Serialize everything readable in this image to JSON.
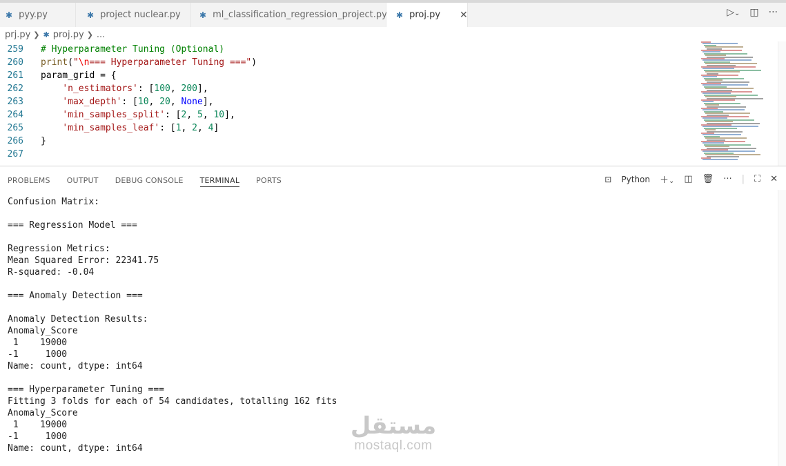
{
  "tabs": [
    {
      "label": "pyy.py",
      "active": false
    },
    {
      "label": "project nuclear.py",
      "active": false
    },
    {
      "label": "ml_classification_regression_project.py",
      "active": false
    },
    {
      "label": "proj.py",
      "active": true
    }
  ],
  "tab_actions": {
    "run_icon": "play-icon",
    "split_icon": "split-editor-icon",
    "more_icon": "more-icon"
  },
  "breadcrumb": {
    "folder": "prj.py",
    "file": "proj.py",
    "ellipsis": "..."
  },
  "editor": {
    "lines": [
      {
        "n": "259",
        "tokens": [
          {
            "t": "# Hyperparameter Tuning (Optional)",
            "c": "comment"
          }
        ]
      },
      {
        "n": "260",
        "tokens": [
          {
            "t": "print",
            "c": "func"
          },
          {
            "t": "(",
            "c": "plain"
          },
          {
            "t": "\"",
            "c": "str"
          },
          {
            "t": "\\n",
            "c": "esc"
          },
          {
            "t": "=== Hyperparameter Tuning ===\"",
            "c": "str"
          },
          {
            "t": ")",
            "c": "plain"
          }
        ]
      },
      {
        "n": "261",
        "tokens": [
          {
            "t": "param_grid = {",
            "c": "plain"
          }
        ]
      },
      {
        "n": "262",
        "tokens": [
          {
            "t": "    ",
            "c": "plain"
          },
          {
            "t": "'n_estimators'",
            "c": "str"
          },
          {
            "t": ": [",
            "c": "plain"
          },
          {
            "t": "100",
            "c": "num"
          },
          {
            "t": ", ",
            "c": "plain"
          },
          {
            "t": "200",
            "c": "num"
          },
          {
            "t": "],",
            "c": "plain"
          }
        ]
      },
      {
        "n": "263",
        "tokens": [
          {
            "t": "    ",
            "c": "plain"
          },
          {
            "t": "'max_depth'",
            "c": "str"
          },
          {
            "t": ": [",
            "c": "plain"
          },
          {
            "t": "10",
            "c": "num"
          },
          {
            "t": ", ",
            "c": "plain"
          },
          {
            "t": "20",
            "c": "num"
          },
          {
            "t": ", ",
            "c": "plain"
          },
          {
            "t": "None",
            "c": "kw"
          },
          {
            "t": "],",
            "c": "plain"
          }
        ]
      },
      {
        "n": "264",
        "tokens": [
          {
            "t": "    ",
            "c": "plain"
          },
          {
            "t": "'min_samples_split'",
            "c": "str"
          },
          {
            "t": ": [",
            "c": "plain"
          },
          {
            "t": "2",
            "c": "num"
          },
          {
            "t": ", ",
            "c": "plain"
          },
          {
            "t": "5",
            "c": "num"
          },
          {
            "t": ", ",
            "c": "plain"
          },
          {
            "t": "10",
            "c": "num"
          },
          {
            "t": "],",
            "c": "plain"
          }
        ]
      },
      {
        "n": "265",
        "tokens": [
          {
            "t": "    ",
            "c": "plain"
          },
          {
            "t": "'min_samples_leaf'",
            "c": "str"
          },
          {
            "t": ": [",
            "c": "plain"
          },
          {
            "t": "1",
            "c": "num"
          },
          {
            "t": ", ",
            "c": "plain"
          },
          {
            "t": "2",
            "c": "num"
          },
          {
            "t": ", ",
            "c": "plain"
          },
          {
            "t": "4",
            "c": "num"
          },
          {
            "t": "]",
            "c": "plain"
          }
        ]
      },
      {
        "n": "266",
        "tokens": [
          {
            "t": "}",
            "c": "plain"
          }
        ]
      },
      {
        "n": "267",
        "tokens": [
          {
            "t": "",
            "c": "plain"
          }
        ]
      }
    ]
  },
  "panel": {
    "tabs": [
      {
        "label": "PROBLEMS",
        "active": false
      },
      {
        "label": "OUTPUT",
        "active": false
      },
      {
        "label": "DEBUG CONSOLE",
        "active": false
      },
      {
        "label": "TERMINAL",
        "active": true
      },
      {
        "label": "PORTS",
        "active": false
      }
    ],
    "terminal_profile": "Python"
  },
  "terminal": {
    "lines": [
      "Confusion Matrix:",
      "",
      "=== Regression Model ===",
      "",
      "Regression Metrics:",
      "Mean Squared Error: 22341.75",
      "R-squared: -0.04",
      "",
      "=== Anomaly Detection ===",
      "",
      "Anomaly Detection Results:",
      "Anomaly_Score",
      " 1    19000",
      "-1     1000",
      "Name: count, dtype: int64",
      "",
      "=== Hyperparameter Tuning ===",
      "Fitting 3 folds for each of 54 candidates, totalling 162 fits",
      "Anomaly_Score",
      " 1    19000",
      "-1     1000",
      "Name: count, dtype: int64"
    ]
  },
  "watermark": {
    "arabic": "مستقل",
    "latin": "mostaql.com"
  },
  "colors": {
    "tab_bar_bg": "#f3f3f3",
    "line_number": "#237893",
    "comment": "#008000",
    "string": "#a31515",
    "number": "#098658",
    "keyword": "#0000ff",
    "function": "#795e26",
    "python_icon": "#3c78aa"
  }
}
